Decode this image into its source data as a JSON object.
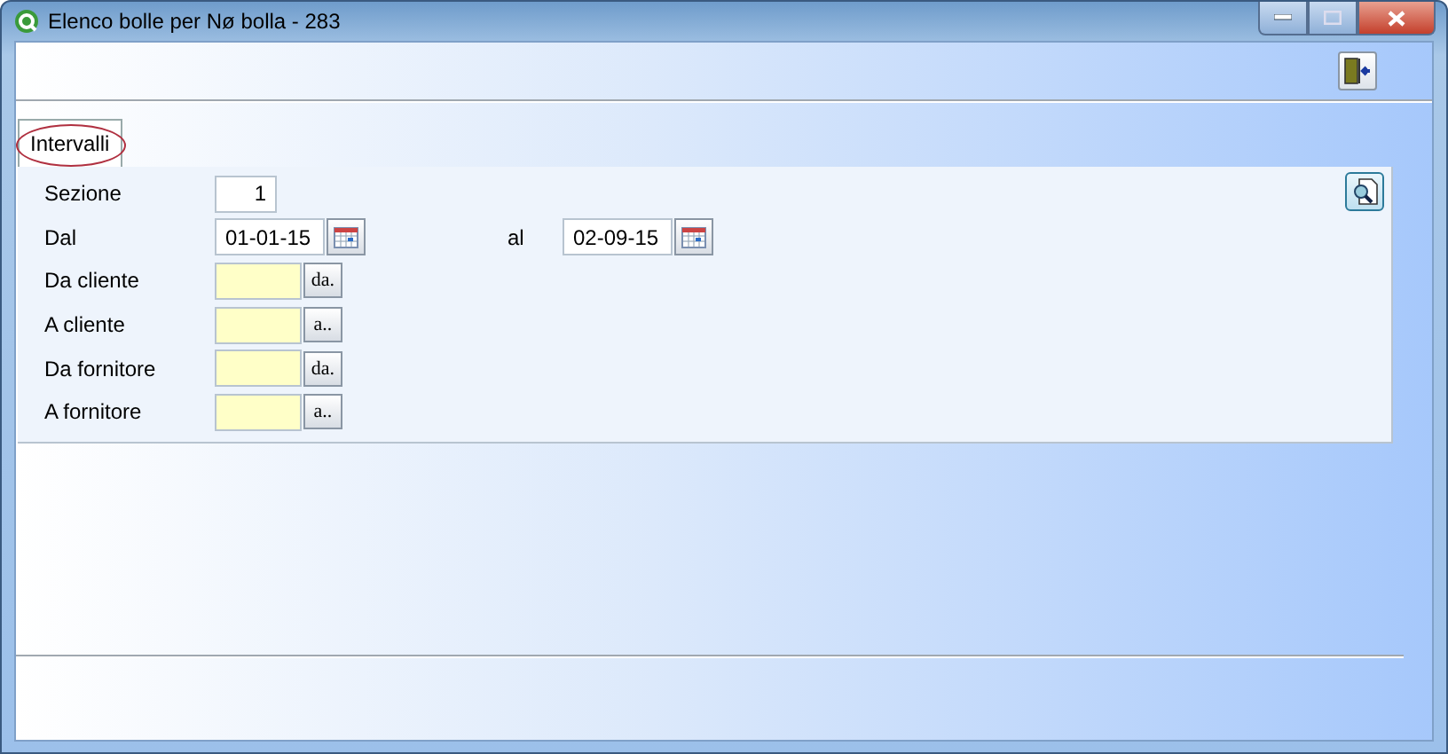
{
  "window": {
    "title": "Elenco bolle per Nø bolla - 283"
  },
  "tabs": [
    {
      "label": "Intervalli",
      "selected": true,
      "circled": true
    }
  ],
  "rows": [
    {
      "kind": "number",
      "label": "Sezione",
      "value": "1"
    },
    {
      "kind": "date",
      "label": "Dal",
      "value": "01-01-15",
      "to_label": "al",
      "to_value": "02-09-15"
    },
    {
      "kind": "lookup",
      "label": "Da cliente",
      "button": "da."
    },
    {
      "kind": "lookup",
      "label": "A cliente",
      "button": "a.."
    },
    {
      "kind": "lookup",
      "label": "Da fornitore",
      "button": "da."
    },
    {
      "kind": "lookup",
      "label": "A fornitore",
      "button": "a.."
    }
  ]
}
